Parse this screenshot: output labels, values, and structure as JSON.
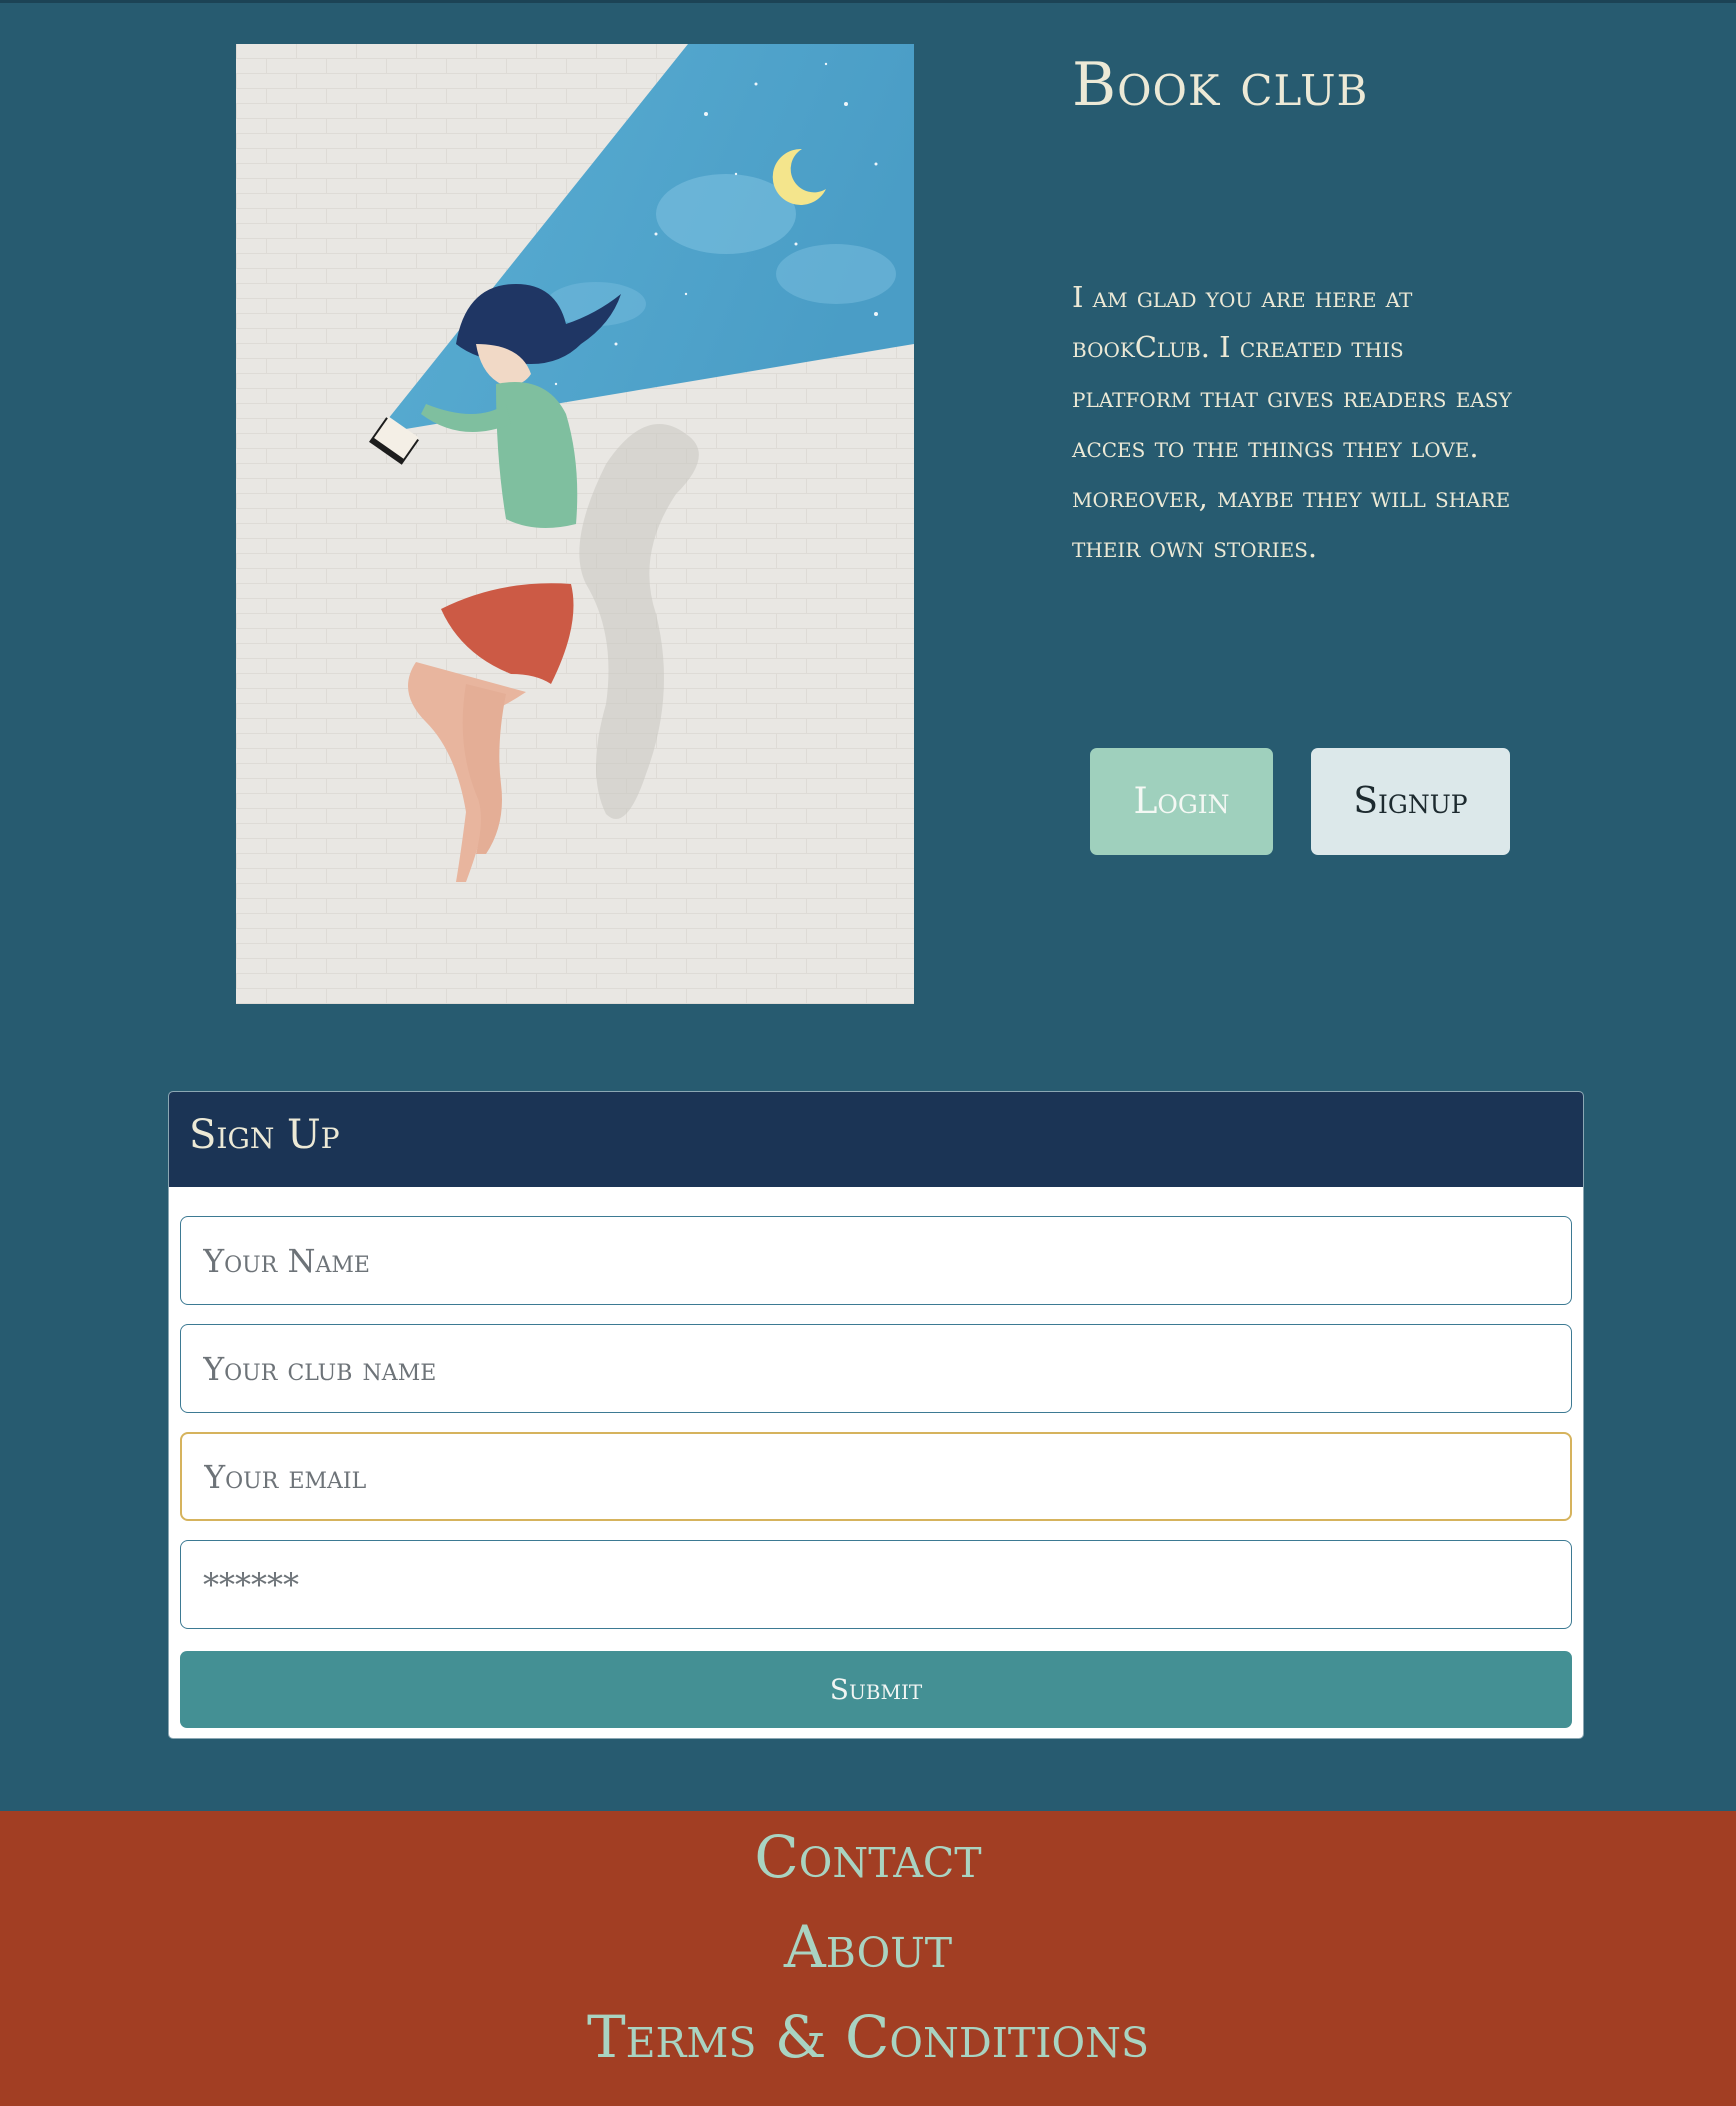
{
  "colors": {
    "page_bg": "#275b70",
    "footer_bg": "#a23e23",
    "card_header_bg": "#1b3455",
    "login_bg": "#9fd0bd",
    "signup_bg": "#dce8ea",
    "submit_bg": "#449094",
    "focus_border": "#d6b35d"
  },
  "hero": {
    "title": "Book club",
    "intro": "I am glad you are here at bookClub. I created this platform that gives readers easy acces to the things they love. moreover, maybe they will share their own stories.",
    "login_label": "Login",
    "signup_label": "Signup"
  },
  "signup_form": {
    "title": "Sign Up",
    "name_placeholder": "Your Name",
    "club_placeholder": "Your club name",
    "email_placeholder": "Your email",
    "password_placeholder": "******",
    "submit_label": "Submit"
  },
  "footer": {
    "links": [
      "Contact",
      "About",
      "Terms & Conditions"
    ]
  }
}
